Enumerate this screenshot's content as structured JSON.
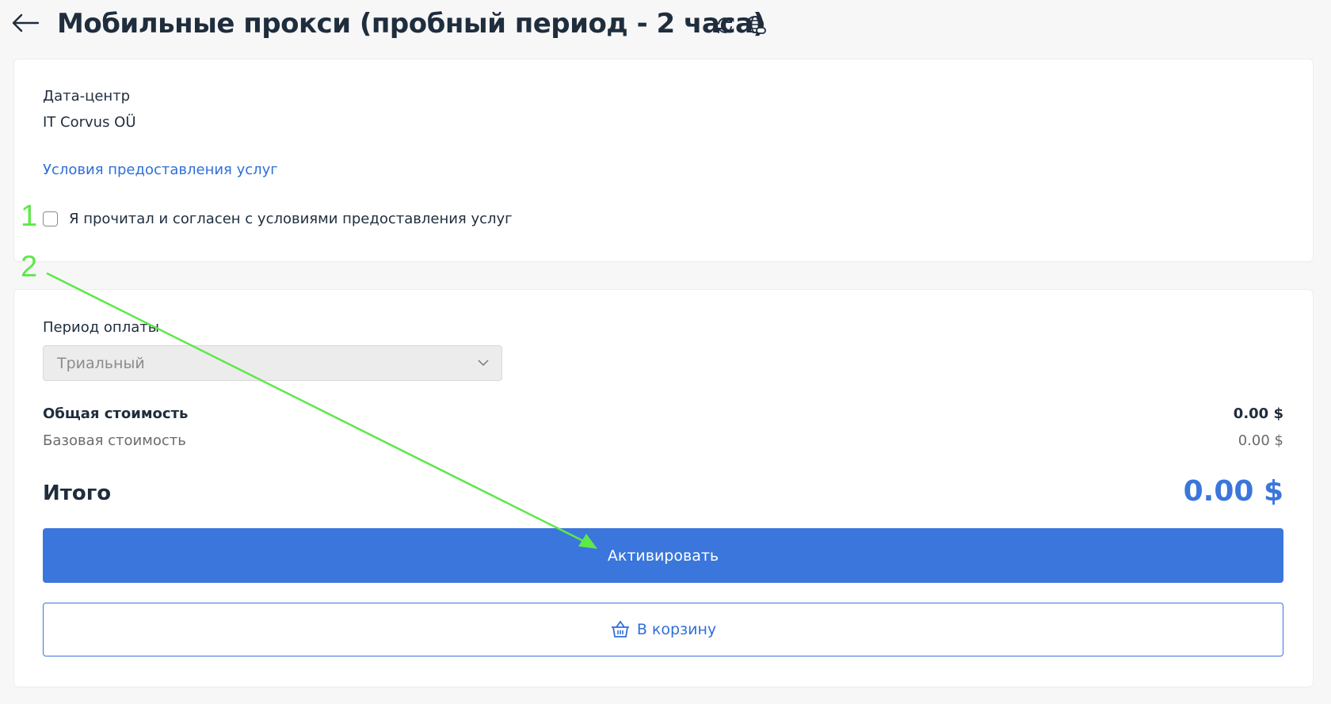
{
  "header": {
    "back_icon": "arrow-left-icon",
    "title": "Мобильные прокси (пробный период - 2 часа)",
    "icons": [
      "refresh-icon",
      "globe-link-icon"
    ]
  },
  "datacenter": {
    "label": "Дата-центр",
    "value": "IT Corvus OÜ"
  },
  "terms": {
    "link_label": "Условия предоставления услуг",
    "agree_label": "Я прочитал и согласен с условиями предоставления услуг",
    "agree_checked": false
  },
  "payment": {
    "period_label": "Период оплаты",
    "period_value": "Триальный",
    "total_label": "Общая стоимость",
    "total_value": "0.00 $",
    "base_label": "Базовая стоимость",
    "base_value": "0.00 $",
    "grand_label": "Итого",
    "grand_value": "0.00 $"
  },
  "buttons": {
    "activate": "Активировать",
    "cart": "В корзину"
  },
  "annotations": {
    "step1": "1",
    "step2": "2",
    "color": "#5ee84a"
  },
  "colors": {
    "accent": "#3a76db",
    "text": "#1f2d3d"
  }
}
